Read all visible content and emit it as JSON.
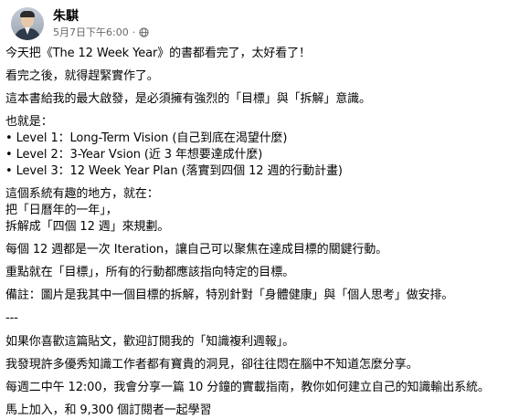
{
  "post": {
    "author": "朱騏",
    "timestamp": "5月7日下午6:00",
    "separator": "·",
    "privacy_icon": "globe-icon",
    "lines": {
      "l1": "今天把《The 12 Week Year》的書都看完了，太好看了！",
      "l2": "看完之後，就得趕緊實作了。",
      "l3": "這本書給我的最大啟發，是必須擁有強烈的「目標」與「拆解」意識。",
      "l4": "也就是：",
      "l5": "• Level 1：Long-Term Vision (自己到底在渴望什麼)",
      "l6": "• Level 2：3-Year Vsion (近 3 年想要達成什麼)",
      "l7": "• Level 3：12 Week Year Plan (落實到四個 12 週的行動計畫)",
      "l8": "這個系統有趣的地方，就在：",
      "l9": "把「日曆年的一年」，",
      "l10": "拆解成「四個 12 週」來規劃。",
      "l11": "每個 12 週都是一次 Iteration，讓自己可以聚焦在達成目標的關鍵行動。",
      "l12": "重點就在「目標」，所有的行動都應該指向特定的目標。",
      "l13": "備註：圖片是我其中一個目標的拆解，特別針對「身體健康」與「個人思考」做安排。",
      "l14": "---",
      "l15": "如果你喜歡這篇貼文，歡迎訂閱我的「知識複利週報」。",
      "l16": "我發現許多優秀知識工作者都有寶貴的洞見，卻往往悶在腦中不知道怎麼分享。",
      "l17": "每週二中午 12:00，我會分享一篇 10 分鐘的實載指南，教你如何建立自己的知識輸出系統。",
      "l18": "馬上加入，和 9,300 個訂閱者一起學習"
    }
  },
  "colors": {
    "text_primary": "#050505",
    "text_secondary": "#65676b"
  }
}
